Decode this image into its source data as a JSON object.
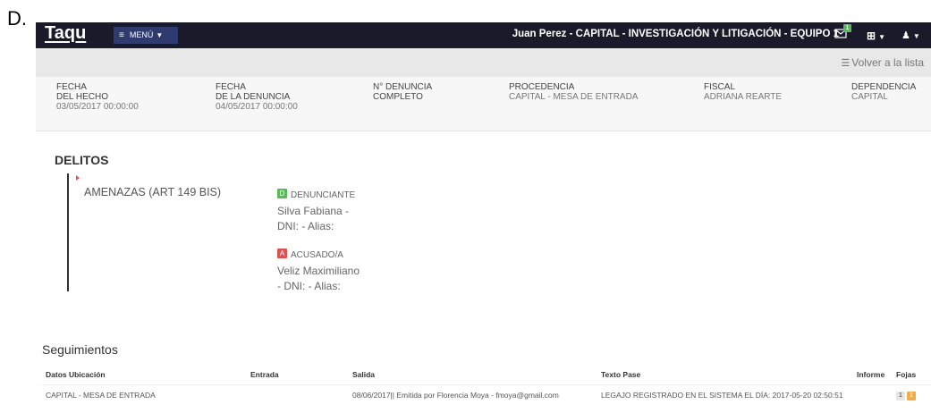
{
  "corner_label": "D.",
  "navbar": {
    "logo": "Taqu",
    "menu_label": "MENÚ",
    "user_title": "Juan Perez - CAPITAL - INVESTIGACIÓN Y LITIGACIÓN - EQUIPO 1",
    "mail_badge": "1",
    "colors": {
      "bar": "#1a1a2a",
      "menu": "#2f3a6e",
      "badge": "#5cb85c"
    }
  },
  "subbar": {
    "back_label": "Volver a la lista"
  },
  "info": [
    {
      "label": "FECHA\nDEL HECHO",
      "value": "03/05/2017 00:00:00"
    },
    {
      "label": "FECHA\nDE LA DENUNCIA",
      "value": "04/05/2017 00:00:00"
    },
    {
      "label": "N° DENUNCIA\nCOMPLETO",
      "value": ""
    },
    {
      "label": "PROCEDENCIA",
      "value": "CAPITAL - MESA DE ENTRADA"
    },
    {
      "label": "FISCAL",
      "value": "ADRIANA REARTE"
    },
    {
      "label": "DEPENDENCIA",
      "value": "CAPITAL"
    }
  ],
  "delitos": {
    "title": "DELITOS",
    "name": "AMENAZAS (ART 149 BIS)",
    "parties": [
      {
        "tag": "D",
        "tag_color": "#5cb85c",
        "role": "DENUNCIANTE",
        "name": "Silva Fabiana - DNI: - Alias:"
      },
      {
        "tag": "A",
        "tag_color": "#d9534f",
        "role": "ACUSADO/A",
        "name": "Veliz Maximiliano - DNI: - Alias:"
      }
    ]
  },
  "seguimientos": {
    "title": "Seguimientos",
    "headers": [
      "Datos Ubicación",
      "Entrada",
      "Salida",
      "Texto Pase",
      "Informe",
      "Fojas"
    ],
    "rows": [
      {
        "ubicacion": "CAPITAL - MESA DE ENTRADA",
        "entrada": "",
        "salida": "08/06/2017|| Emitida por Florencia Moya - fmoya@gmail.com",
        "texto": "LEGAJO REGISTRADO EN EL SISTEMA EL DÍA: 2017-05-20 02:50:51",
        "informe": "",
        "fojas": [
          "1",
          "1"
        ]
      }
    ]
  }
}
